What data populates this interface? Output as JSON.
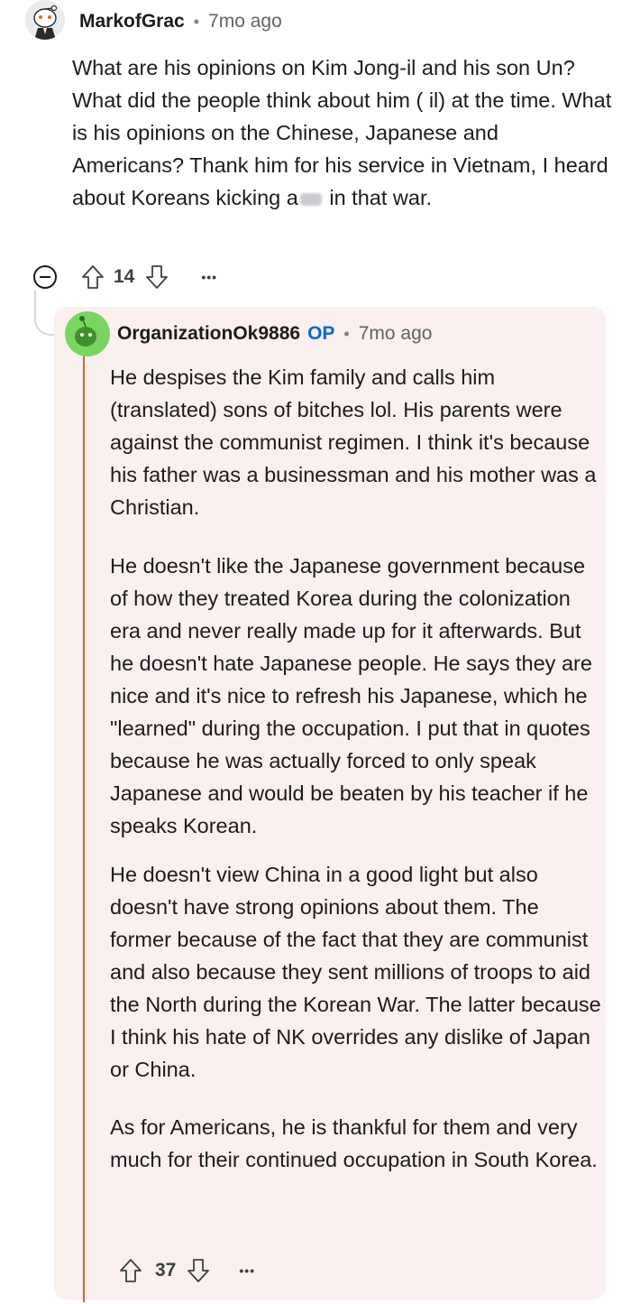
{
  "comment": {
    "username": "MarkofGrac",
    "separator": "•",
    "time": "7mo ago",
    "body_before_redaction": "What are his opinions on Kim Jong-il and his son Un? What did the people think about him ( il) at the time. What is his opinions on the Chinese, Japanese and Americans? Thank him for his service in Vietnam, I heard about Koreans kicking a",
    "body_after_redaction": " in that war.",
    "vote_count": "14",
    "more_label": "•••"
  },
  "reply": {
    "username": "OrganizationOk9886",
    "op_badge": "OP",
    "separator": "•",
    "time": "7mo ago",
    "paragraphs": [
      "He despises the Kim family and calls him (translated) sons of bitches lol. His parents were against the communist regimen. I think it's because his father was a businessman and his mother was a Christian.",
      "He doesn't like the Japanese government because of how they treated Korea during the colonization era and never really made up for it afterwards. But he doesn't hate Japanese people. He says they are nice and it's nice to refresh his Japanese, which he \"learned\" during the occupation. I put that in quotes because he was actually forced to only speak Japanese and would be beaten by his teacher if he speaks Korean.",
      "He doesn't view China in a good light but also doesn't have strong opinions about them. The former because of the fact that they are communist and also because they sent millions of troops to aid the North during the Korean War. The latter because I think his hate of NK overrides any dislike of Japan or China.",
      "As for Americans, he is thankful for them and very much for their continued occupation in South Korea."
    ],
    "vote_count": "37",
    "more_label": "•••"
  },
  "colors": {
    "op_badge": "#0a66d8",
    "reply_background": "#faf0ed",
    "thread_line": "#d9613a",
    "op_avatar": "#78d660"
  },
  "icons": [
    "collapse-icon",
    "upvote-icon",
    "downvote-icon",
    "more-icon"
  ]
}
